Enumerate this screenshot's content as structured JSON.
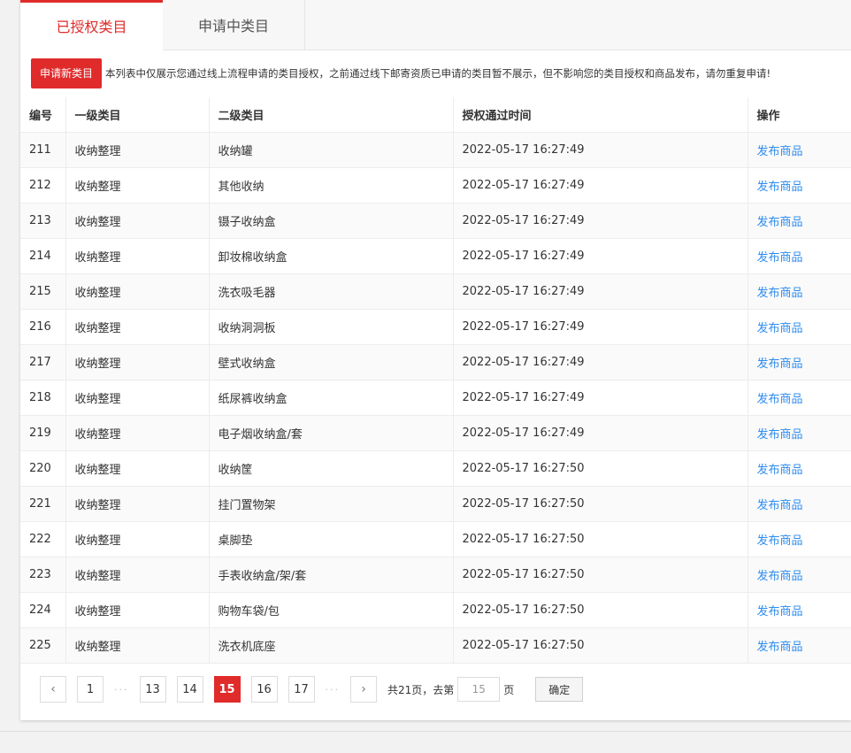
{
  "tabs": [
    {
      "label": "已授权类目",
      "active": true
    },
    {
      "label": "申请中类目",
      "active": false
    }
  ],
  "notice": {
    "button_label": "申请新类目",
    "text": "本列表中仅展示您通过线上流程申请的类目授权，之前通过线下邮寄资质已申请的类目暂不展示，但不影响您的类目授权和商品发布，请勿重复申请!"
  },
  "table": {
    "headers": [
      "编号",
      "一级类目",
      "二级类目",
      "授权通过时间",
      "操作"
    ],
    "rows": [
      {
        "id": "211",
        "level1": "收纳整理",
        "level2": "收纳罐",
        "time": "2022-05-17 16:27:49",
        "action": "发布商品"
      },
      {
        "id": "212",
        "level1": "收纳整理",
        "level2": "其他收纳",
        "time": "2022-05-17 16:27:49",
        "action": "发布商品"
      },
      {
        "id": "213",
        "level1": "收纳整理",
        "level2": "镊子收纳盒",
        "time": "2022-05-17 16:27:49",
        "action": "发布商品"
      },
      {
        "id": "214",
        "level1": "收纳整理",
        "level2": "卸妆棉收纳盒",
        "time": "2022-05-17 16:27:49",
        "action": "发布商品"
      },
      {
        "id": "215",
        "level1": "收纳整理",
        "level2": "洗衣吸毛器",
        "time": "2022-05-17 16:27:49",
        "action": "发布商品"
      },
      {
        "id": "216",
        "level1": "收纳整理",
        "level2": "收纳洞洞板",
        "time": "2022-05-17 16:27:49",
        "action": "发布商品"
      },
      {
        "id": "217",
        "level1": "收纳整理",
        "level2": "壁式收纳盒",
        "time": "2022-05-17 16:27:49",
        "action": "发布商品"
      },
      {
        "id": "218",
        "level1": "收纳整理",
        "level2": "纸尿裤收纳盒",
        "time": "2022-05-17 16:27:49",
        "action": "发布商品"
      },
      {
        "id": "219",
        "level1": "收纳整理",
        "level2": "电子烟收纳盒/套",
        "time": "2022-05-17 16:27:49",
        "action": "发布商品"
      },
      {
        "id": "220",
        "level1": "收纳整理",
        "level2": "收纳筐",
        "time": "2022-05-17 16:27:50",
        "action": "发布商品"
      },
      {
        "id": "221",
        "level1": "收纳整理",
        "level2": "挂门置物架",
        "time": "2022-05-17 16:27:50",
        "action": "发布商品"
      },
      {
        "id": "222",
        "level1": "收纳整理",
        "level2": "桌脚垫",
        "time": "2022-05-17 16:27:50",
        "action": "发布商品"
      },
      {
        "id": "223",
        "level1": "收纳整理",
        "level2": "手表收纳盒/架/套",
        "time": "2022-05-17 16:27:50",
        "action": "发布商品"
      },
      {
        "id": "224",
        "level1": "收纳整理",
        "level2": "购物车袋/包",
        "time": "2022-05-17 16:27:50",
        "action": "发布商品"
      },
      {
        "id": "225",
        "level1": "收纳整理",
        "level2": "洗衣机底座",
        "time": "2022-05-17 16:27:50",
        "action": "发布商品"
      }
    ]
  },
  "pagination": {
    "prev_icon": "chevron-left-icon",
    "next_icon": "chevron-right-icon",
    "first": "1",
    "ellipsis": "···",
    "pages": [
      "13",
      "14",
      "15",
      "16",
      "17"
    ],
    "current": "15",
    "total_text": "共21页，去第",
    "input_value": "15",
    "page_suffix": "页",
    "confirm_label": "确定"
  },
  "colors": {
    "accent": "#e02b2b",
    "link": "#2d8cf0"
  }
}
